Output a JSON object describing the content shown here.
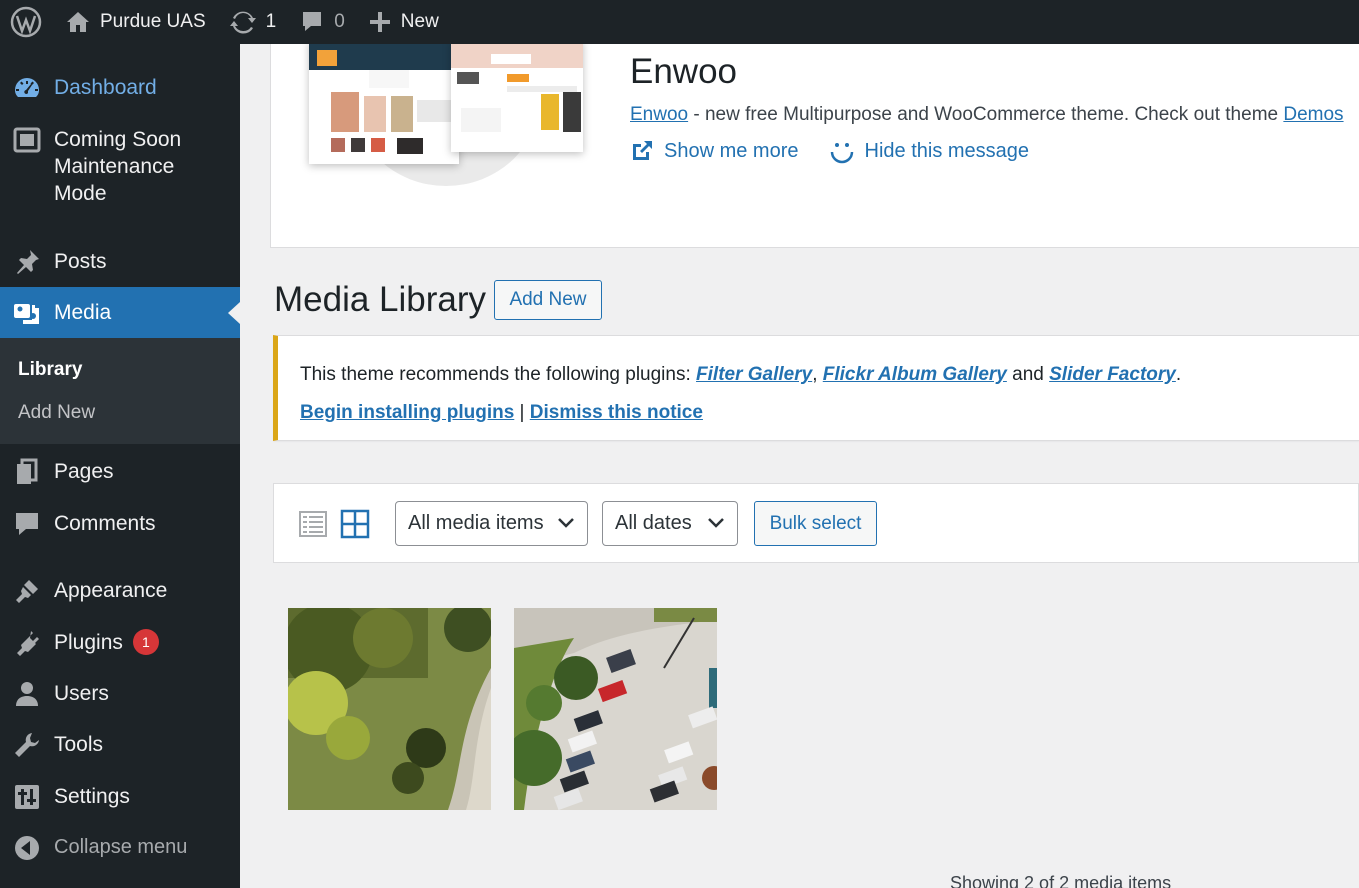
{
  "adminbar": {
    "site_name": "Purdue UAS",
    "updates_count": "1",
    "comments_count": "0",
    "new_label": "New",
    "icons": [
      "wordpress-logo-icon",
      "home-icon",
      "updates-icon",
      "comment-icon",
      "plus-icon"
    ]
  },
  "sidebar": {
    "items": [
      {
        "label": "Dashboard",
        "icon": "dashboard-icon"
      },
      {
        "label": "Coming Soon",
        "label2": "Maintenance",
        "label3": "Mode",
        "icon": "coming-soon-icon"
      },
      {
        "label": "Posts",
        "icon": "pushpin-icon"
      },
      {
        "label": "Media",
        "icon": "media-icon"
      },
      {
        "label": "Pages",
        "icon": "pages-icon"
      },
      {
        "label": "Comments",
        "icon": "comments-icon"
      },
      {
        "label": "Appearance",
        "icon": "paintbrush-icon"
      },
      {
        "label": "Plugins",
        "icon": "plugin-icon",
        "badge": "1"
      },
      {
        "label": "Users",
        "icon": "users-icon"
      },
      {
        "label": "Tools",
        "icon": "wrench-icon"
      },
      {
        "label": "Settings",
        "icon": "settings-icon"
      },
      {
        "label": "Collapse menu",
        "icon": "collapse-icon"
      }
    ],
    "submenu": {
      "library": "Library",
      "add_new": "Add New"
    }
  },
  "promo": {
    "title": "Enwoo",
    "desc_link": "Enwoo",
    "desc_text": " - new free Multipurpose and WooCommerce theme. Check out theme ",
    "demos_link": "Demos",
    "show_more": "Show me more",
    "hide_message": "Hide this message"
  },
  "page": {
    "title": "Media Library",
    "add_new": "Add New"
  },
  "notice": {
    "text_before": "This theme recommends the following plugins: ",
    "plugin1": "Filter Gallery",
    "sep1": ", ",
    "plugin2": "Flickr Album Gallery",
    "and": " and ",
    "plugin3": "Slider Factory",
    "period": ".",
    "install_link": "Begin installing plugins",
    "divider": " | ",
    "dismiss_link": "Dismiss this notice"
  },
  "toolbar": {
    "filter_type": "All media items",
    "filter_date": "All dates",
    "bulk_select": "Bulk select"
  },
  "status": {
    "showing": "Showing 2 of 2 media items"
  },
  "colors": {
    "adminbar_bg": "#1d2327",
    "menu_current": "#2271b1",
    "notice_warning": "#dba617",
    "badge": "#d63638"
  }
}
